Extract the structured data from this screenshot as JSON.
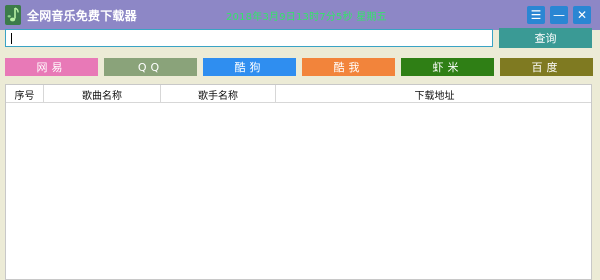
{
  "window": {
    "title": "全网音乐免费下载器",
    "datetime": "2018年3月9日13时7分5秒  星期五",
    "controls": {
      "menu_glyph": "☰",
      "minimize_glyph": "—",
      "close_glyph": "✕"
    },
    "icon": "music-note-icon"
  },
  "search": {
    "value": "",
    "placeholder": "",
    "button_label": "查询"
  },
  "sources": [
    {
      "label": "网易",
      "color": "#e879b7"
    },
    {
      "label": "QQ",
      "color": "#8aa37a"
    },
    {
      "label": "酷狗",
      "color": "#2f8ef0"
    },
    {
      "label": "酷我",
      "color": "#f2843b"
    },
    {
      "label": "虾米",
      "color": "#2f7f15"
    },
    {
      "label": "百度",
      "color": "#7f7a21"
    }
  ],
  "table": {
    "columns": [
      "序号",
      "歌曲名称",
      "歌手名称",
      "下载地址"
    ],
    "rows": []
  },
  "colors": {
    "titlebar": "#8d87c6",
    "datetime": "#35e36a",
    "search_button": "#3a9a95",
    "window_bg": "#ecebd6"
  }
}
